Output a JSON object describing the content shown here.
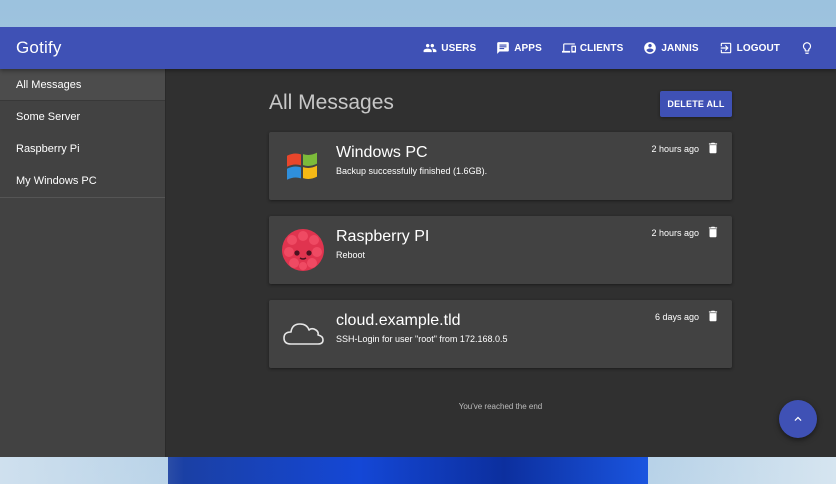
{
  "app": {
    "title": "Gotify"
  },
  "nav": {
    "users": {
      "label": "USERS",
      "icon": "users-icon"
    },
    "apps": {
      "label": "APPS",
      "icon": "apps-message-icon"
    },
    "clients": {
      "label": "CLIENTS",
      "icon": "clients-devices-icon"
    },
    "account": {
      "label": "JANNIS",
      "icon": "account-circle-icon"
    },
    "logout": {
      "label": "LOGOUT",
      "icon": "logout-icon"
    },
    "theme": {
      "icon": "lightbulb-icon"
    }
  },
  "sidebar": {
    "items": [
      {
        "label": "All Messages",
        "active": true
      },
      {
        "label": "Some Server",
        "active": false
      },
      {
        "label": "Raspberry Pi",
        "active": false
      },
      {
        "label": "My Windows PC",
        "active": false
      }
    ]
  },
  "main": {
    "title": "All Messages",
    "delete_all_label": "DELETE ALL",
    "messages": [
      {
        "title": "Windows PC",
        "message": "Backup successfully finished (1.6GB).",
        "date": "2 hours ago",
        "icon": "windows-logo-icon"
      },
      {
        "title": "Raspberry PI",
        "message": "Reboot",
        "date": "2 hours ago",
        "icon": "raspberry-icon"
      },
      {
        "title": "cloud.example.tld",
        "message": "SSH-Login for user \"root\" from 172.168.0.5",
        "date": "6 days ago",
        "icon": "cloud-icon"
      }
    ],
    "end_text": "You've reached the end"
  },
  "colors": {
    "primary": "#3f51b5",
    "background": "#303030",
    "surface": "#424242",
    "text": "#ffffff"
  }
}
